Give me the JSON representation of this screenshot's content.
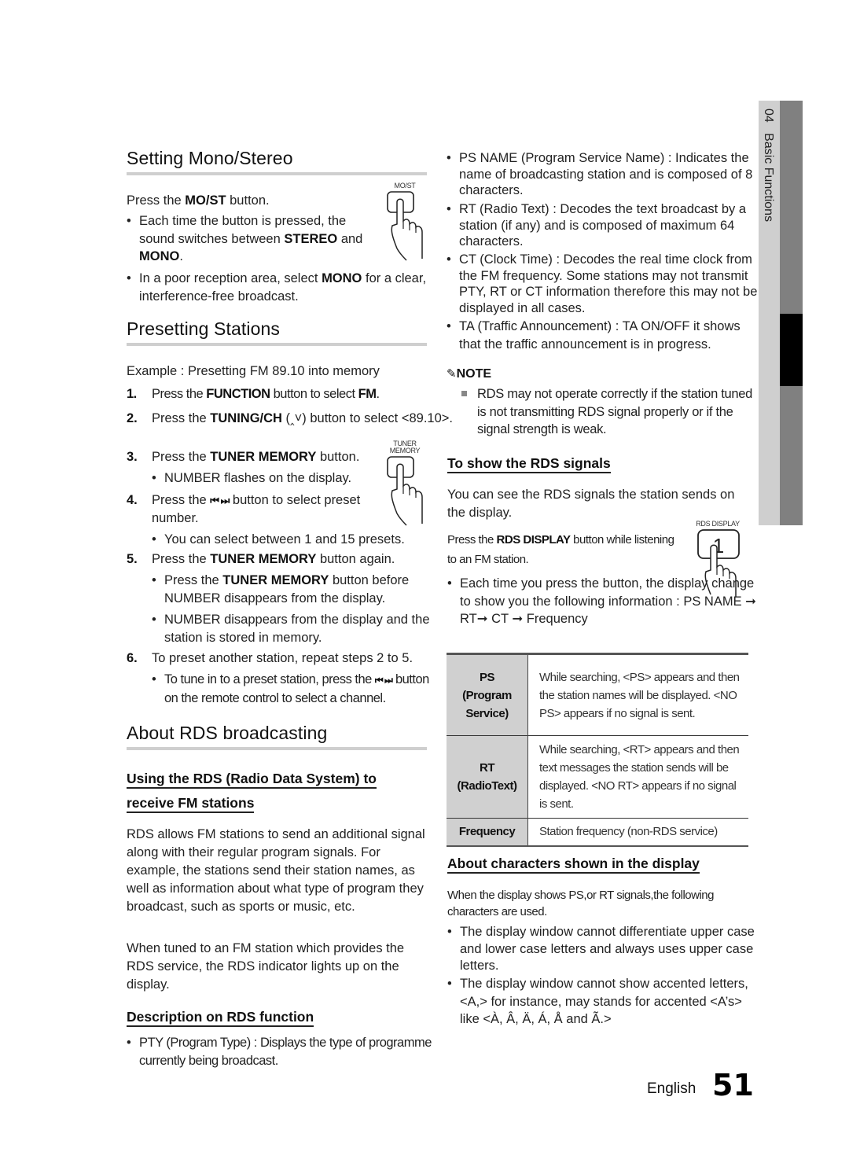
{
  "side_tab": {
    "chapter": "04",
    "section": "Basic Functions"
  },
  "mono_stereo": {
    "title": "Setting Mono/Stereo",
    "intro": [
      "Press the ",
      "MO/ST",
      " button."
    ],
    "button_caption": "MO/ST",
    "bullets": [
      [
        "Each time the button is pressed, the sound switches between ",
        "STEREO",
        " and ",
        "MONO",
        "."
      ],
      [
        "In a poor reception area, select ",
        "MONO",
        " for a clear, interference-free broadcast."
      ]
    ]
  },
  "presetting": {
    "title": "Presetting Stations",
    "example": "Example : Presetting FM 89.10 into memory",
    "tuner_caption_1": "TUNER",
    "tuner_caption_2": "MEMORY",
    "steps": [
      {
        "n": "1.",
        "parts": [
          "Press the ",
          "FUNCTION",
          " button to select ",
          "FM",
          "."
        ]
      },
      {
        "n": "2.",
        "parts": [
          "Press the ",
          "TUNING/CH",
          " (‸˅) button to select <89.10>."
        ]
      },
      {
        "n": "3.",
        "parts": [
          "Press the ",
          "TUNER MEMORY",
          " button."
        ]
      },
      {
        "n": "4.",
        "parts": [
          "Press the ",
          "⏮ ⏭",
          " button to select preset number."
        ]
      },
      {
        "n": "5.",
        "parts": [
          "Press the ",
          "TUNER MEMORY",
          " button again."
        ]
      },
      {
        "n": "6.",
        "parts": [
          "To preset another station, repeat steps 2 to 5."
        ]
      }
    ],
    "step3_bullet": "NUMBER flashes on the display.",
    "step4_bullet": "You can select between 1 and 15 presets.",
    "step5_bullets": [
      [
        "Press the ",
        "TUNER MEMORY",
        " button before NUMBER disappears from the display."
      ],
      [
        "NUMBER disappears from the display and the station is stored in memory."
      ]
    ],
    "step6_bullet": [
      "To tune in to a preset station, press the ",
      "⏮ ⏭",
      " button on the remote control to select a channel."
    ]
  },
  "rds": {
    "title": "About RDS broadcasting",
    "using_heading_1": "Using the RDS (Radio Data System) to",
    "using_heading_2": "receive FM stations",
    "para1": "RDS allows FM stations to send an additional signal along with their regular program signals. For example, the stations send their station names, as well as information about what type of program they broadcast, such as sports or music, etc.",
    "para2": "When tuned to an FM station which provides the RDS service, the RDS indicator lights up on the display.",
    "description_heading": "Description on RDS function",
    "functions": [
      "PTY (Program Type) : Displays the type of programme currently being broadcast.",
      "PS NAME (Program Service Name) : Indicates the name of broadcasting station and is composed of 8 characters.",
      "RT (Radio Text) : Decodes the text broadcast by a station (if any) and is composed of maximum 64 characters.",
      "CT (Clock Time) : Decodes the real time clock from the FM frequency. Some stations may not transmit PTY, RT or CT information therefore this may not be displayed in all cases.",
      "TA (Traffic Announcement) : TA ON/OFF it shows that the traffic announcement is in progress."
    ],
    "note_label": "NOTE",
    "note_text": "RDS may not operate correctly if the station tuned is not transmitting RDS signal properly or if the signal strength is weak."
  },
  "show_signals": {
    "heading": "To show the RDS signals",
    "intro": "You can see the RDS signals the station sends on the display.",
    "press": [
      "Press the ",
      "RDS DISPLAY",
      " button while listening to an FM station."
    ],
    "button_caption": "RDS DISPLAY",
    "bullet": "Each time you press the button, the display change to show you the following information : PS NAME ➞ RT➞ CT ➞ Frequency",
    "table": [
      {
        "key": "PS",
        "sub": "(Program Service)",
        "value": "While searching, <PS> appears and then the station names will be displayed. <NO PS> appears if no signal is sent."
      },
      {
        "key": "RT",
        "sub": "(RadioText)",
        "value": "While searching, <RT> appears and then text messages the station sends will be displayed. <NO RT> appears if no signal is sent."
      },
      {
        "key": "Frequency",
        "sub": "",
        "value": "Station frequency (non-RDS service)"
      }
    ]
  },
  "characters": {
    "heading": "About characters shown in the display",
    "intro": "When the display shows PS,or RT signals,the following characters are used.",
    "bullets": [
      "The display window cannot differentiate upper case and lower case letters and always uses upper case letters.",
      "The display window cannot show accented letters, <A,> for instance, may stands for accented <A’s> like <À, Â, Ä, Á, Å and Ã.>"
    ]
  },
  "footer": {
    "language": "English",
    "page": "51"
  }
}
